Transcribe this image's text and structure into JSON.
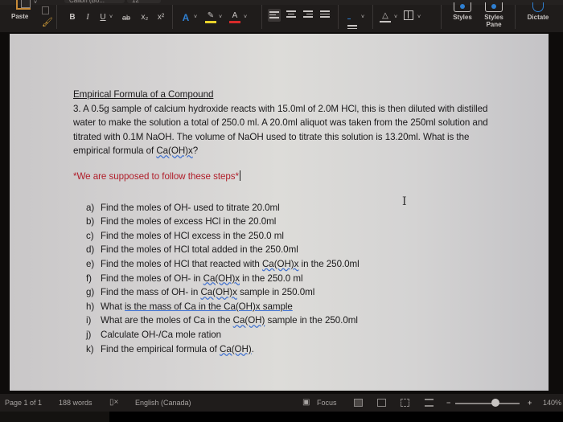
{
  "ribbon": {
    "font_name": "Calibri (Bo...",
    "font_size": "12",
    "paste_label": "Paste",
    "bold": "B",
    "italic": "I",
    "underline": "U",
    "strikethrough": "ab",
    "subscript": "x₂",
    "superscript": "x²",
    "text_effects": "A",
    "highlight": "✎",
    "font_color": "A",
    "chevron": "˅",
    "styles_label": "Styles",
    "styles_pane_label_1": "Styles",
    "styles_pane_label_2": "Pane",
    "dictate_label": "Dictate",
    "colors": {
      "highlight_yellow": "#e8d12a",
      "font_color_red": "#d62a2a",
      "text_effects_blue": "#2f7fd1",
      "paste_orange": "#c98b38"
    }
  },
  "document": {
    "title": "Empirical Formula of a Compound",
    "problem_parts": [
      "3. A 0.5g sample of calcium hydroxide reacts with 15.0ml of 2.0M HCl, this is then diluted with distilled water to make the solution a total of 250.0 ml. A 20.0ml aliquot was taken from the 250ml solution and titrated with 0.1M NaOH. The volume of NaOH used to titrate this solution is 13.20ml. What is the empirical formula of ",
      "Ca(OH)x",
      "?"
    ],
    "note": "*We are supposed to follow these steps*",
    "steps": [
      {
        "label": "a)",
        "parts": [
          "Find the moles of OH- used to titrate 20.0ml"
        ]
      },
      {
        "label": "b)",
        "parts": [
          "Find the moles of excess HCl in the 20.0ml"
        ]
      },
      {
        "label": "c)",
        "parts": [
          "Find the moles of HCl excess in the 250.0 ml"
        ]
      },
      {
        "label": "d)",
        "parts": [
          "Find the moles of HCl total added in the 250.0ml"
        ]
      },
      {
        "label": "e)",
        "parts": [
          "Find the moles of HCl that reacted with ",
          "Ca(OH)x",
          "  in the 250.0ml"
        ]
      },
      {
        "label": "f)",
        "parts": [
          "Find the moles of OH- in ",
          "Ca(OH)x",
          " in the 250.0 ml"
        ]
      },
      {
        "label": "g)",
        "parts": [
          "Find the mass of OH- in ",
          "Ca(OH)x",
          " sample in 250.0ml"
        ]
      },
      {
        "label": "h)",
        "parts": [
          "What ",
          "is the mass of Ca in the Ca(OH)x sample",
          ""
        ]
      },
      {
        "label": "i)",
        "parts": [
          "What are the moles of Ca in the ",
          "Ca(OH)",
          " sample in the 250.0ml"
        ]
      },
      {
        "label": "j)",
        "parts": [
          "Calculate OH-/Ca mole ration"
        ]
      },
      {
        "label": "k)",
        "parts": [
          "Find the empirical formula of ",
          "Ca(OH)",
          "."
        ]
      }
    ]
  },
  "status_bar": {
    "page": "Page 1 of 1",
    "words": "188 words",
    "language": "English (Canada)",
    "focus_label": "Focus",
    "zoom_minus": "−",
    "zoom_plus": "+",
    "zoom_level": "140%",
    "zoom_fraction": 0.62
  }
}
